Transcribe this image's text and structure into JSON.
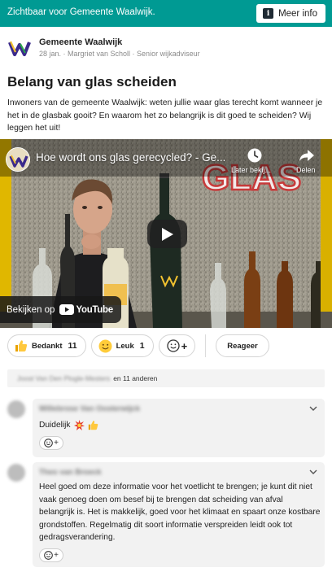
{
  "banner": {
    "text": "Zichtbaar voor Gemeente Waalwijk.",
    "info_label": "Meer info",
    "color": "#009a93"
  },
  "post": {
    "org": "Gemeente Waalwijk",
    "meta": "28 jan. · Margriet van Scholl · Senior wijkadviseur",
    "title": "Belang van glas scheiden",
    "body": "Inwoners van de gemeente Waalwijk: weten jullie waar glas terecht komt wanneer je het in de glasbak gooit? En waarom het zo belangrijk is dit goed te scheiden? Wij leggen het uit!"
  },
  "video": {
    "title": "Hoe wordt ons glas gerecycled? - Ge...",
    "watch_later": "Later bekij...",
    "share": "Delen",
    "watch_on": "Bekijken op",
    "youtube": "YouTube",
    "overlay_word": "GLAS"
  },
  "reactions": {
    "thanks_label": "Bedankt",
    "thanks_count": "11",
    "like_label": "Leuk",
    "like_count": "1",
    "add_emoji": "+",
    "reply_label": "Reageer"
  },
  "reactors": {
    "name": "Joost Van Den Plogle-Mesters",
    "others": "en 11 anderen"
  },
  "comments": [
    {
      "author": "Willebrose Van Oosterwijck",
      "text": "Duidelijk",
      "react_plus": "+"
    },
    {
      "author": "Theo van Broeck",
      "text": "Heel goed om deze informatie voor het voetlicht te brengen; je kunt dit niet vaak genoeg doen om besef bij te brengen dat scheiding van afval belangrijk is. Het is makkelijk, goed voor het klimaat en spaart onze kostbare grondstoffen. Regelmatig dit soort informatie verspreiden leidt ook tot gedragsverandering.",
      "react_plus": "+"
    }
  ],
  "icons": [
    "info-icon",
    "waalwijk-logo",
    "clock-icon",
    "share-icon",
    "play-icon",
    "youtube-logo",
    "thumbs-up-icon",
    "smiley-icon",
    "chevron-down-icon",
    "explosion-icon"
  ]
}
